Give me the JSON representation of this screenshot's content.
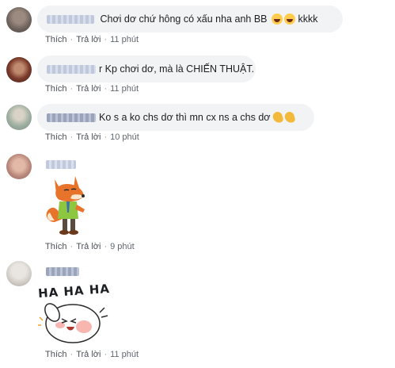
{
  "comments": [
    {
      "text": "Chơi dơ chứ hông có xấu nha anh BB",
      "suffix": "kkkk",
      "actions": {
        "like": "Thích",
        "reply": "Trả lời",
        "time": "11 phút"
      }
    },
    {
      "text": "r Kp chơi dơ, mà là CHIẾN THUẬT.",
      "actions": {
        "like": "Thích",
        "reply": "Trả lời",
        "time": "11 phút"
      }
    },
    {
      "text": "Ko s a ko chs dơ thì mn cx ns a chs dơ",
      "actions": {
        "like": "Thích",
        "reply": "Trả lời",
        "time": "10 phút"
      }
    },
    {
      "sticker": "fox-sticker",
      "actions": {
        "like": "Thích",
        "reply": "Trả lời",
        "time": "9 phút"
      }
    },
    {
      "sticker_text": "HA HA HA",
      "actions": {
        "like": "Thích",
        "reply": "Trả lời",
        "time": "11 phút"
      }
    }
  ],
  "colors": {
    "bubble": "#f2f3f5",
    "action_text": "#606770",
    "fox_orange": "#e8742c",
    "bunny_pink": "#f7b6b0"
  },
  "icons": {
    "emoji": "laughing-face-icon",
    "clap": "clapping-hands-icon"
  }
}
